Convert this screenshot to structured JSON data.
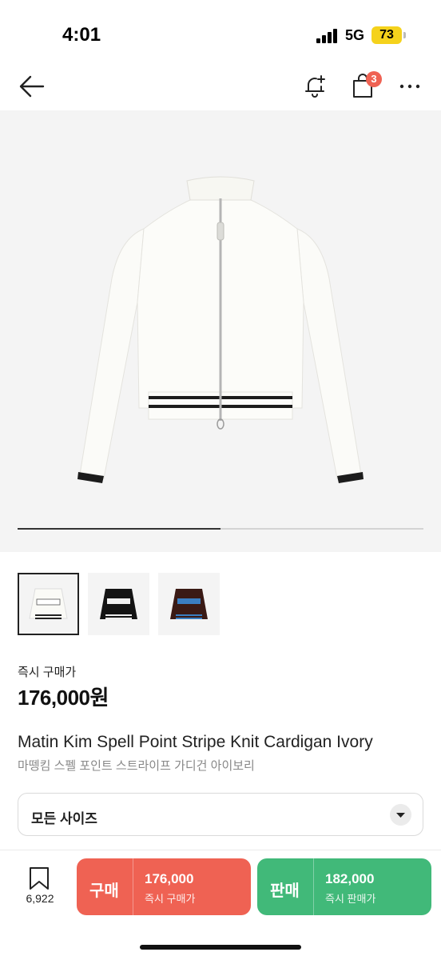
{
  "status_bar": {
    "time": "4:01",
    "network": "5G",
    "battery": "73"
  },
  "nav": {
    "cart_badge": "3"
  },
  "product": {
    "price_label": "즉시 구매가",
    "price": "176,000원",
    "name_en": "Matin Kim Spell Point Stripe Knit Cardigan Ivory",
    "name_ko": "마뗑킴 스펠 포인트 스트라이프 가디건 아이보리",
    "image_carousel_progress": 0.5,
    "thumbnails": [
      "ivory",
      "black",
      "brown"
    ]
  },
  "size_select": {
    "value": "모든 사이즈"
  },
  "bottom_bar": {
    "wish_count": "6,922",
    "buy": {
      "label": "구매",
      "amount": "176,000",
      "sub": "즉시 구매가",
      "color": "#ef6253"
    },
    "sell": {
      "label": "판매",
      "amount": "182,000",
      "sub": "즉시 판매가",
      "color": "#41b979"
    }
  }
}
